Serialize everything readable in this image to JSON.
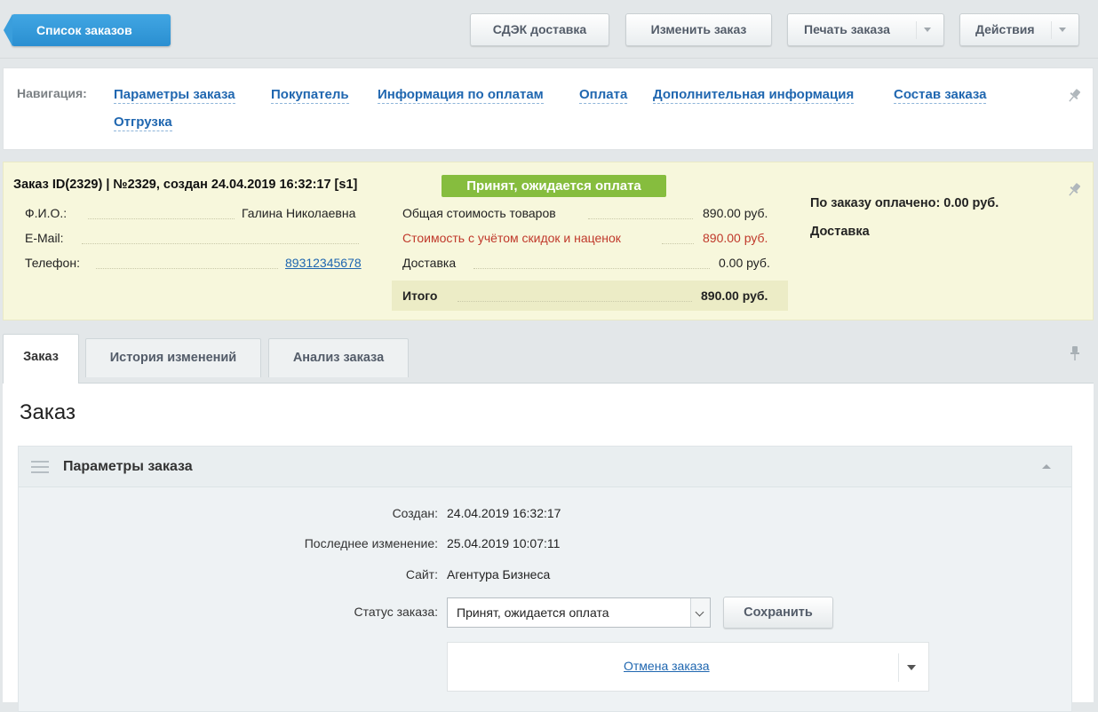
{
  "toolbar": {
    "back_label": "Список заказов",
    "cdek_label": "СДЭК доставка",
    "edit_label": "Изменить заказ",
    "print_label": "Печать заказа",
    "actions_label": "Действия"
  },
  "nav": {
    "label": "Навигация:",
    "links": [
      "Параметры заказа",
      "Покупатель",
      "Информация по оплатам",
      "Оплата",
      "Дополнительная информация",
      "Состав заказа",
      "Отгрузка"
    ]
  },
  "summary": {
    "title": "Заказ ID(2329) | №2329, создан 24.04.2019 16:32:17 [s1]",
    "status": "Принят, ожидается оплата",
    "buyer": {
      "fio_label": "Ф.И.О.:",
      "fio_value": "Галина Николаевна",
      "email_label": "E-Mail:",
      "email_value": "",
      "phone_label": "Телефон:",
      "phone_value": "89312345678"
    },
    "costs": {
      "goods_label": "Общая стоимость товаров",
      "goods_value": "890.00 руб.",
      "discount_label": "Стоимость с учётом скидок и наценок",
      "discount_value": "890.00 руб.",
      "delivery_label": "Доставка",
      "delivery_value": "0.00 руб.",
      "total_label": "Итого",
      "total_value": "890.00 руб."
    },
    "paid": "По заказу оплачено: 0.00 руб.",
    "delivery_heading": "Доставка"
  },
  "tabs": [
    "Заказ",
    "История изменений",
    "Анализ заказа"
  ],
  "main": {
    "title": "Заказ",
    "section_title": "Параметры заказа",
    "created_label": "Создан:",
    "created_value": "24.04.2019 16:32:17",
    "modified_label": "Последнее изменение:",
    "modified_value": "25.04.2019 10:07:11",
    "site_label": "Сайт:",
    "site_value": "Агентура Бизнеса",
    "status_label": "Статус заказа:",
    "status_value": "Принят, ожидается оплата",
    "save_label": "Сохранить",
    "cancel_link": "Отмена заказа"
  },
  "colors": {
    "accent": "#2a8fd1",
    "status_green": "#86bd3e",
    "summary_bg": "#f7f7dc",
    "link": "#2067b0",
    "warning_red": "#c0392b"
  }
}
